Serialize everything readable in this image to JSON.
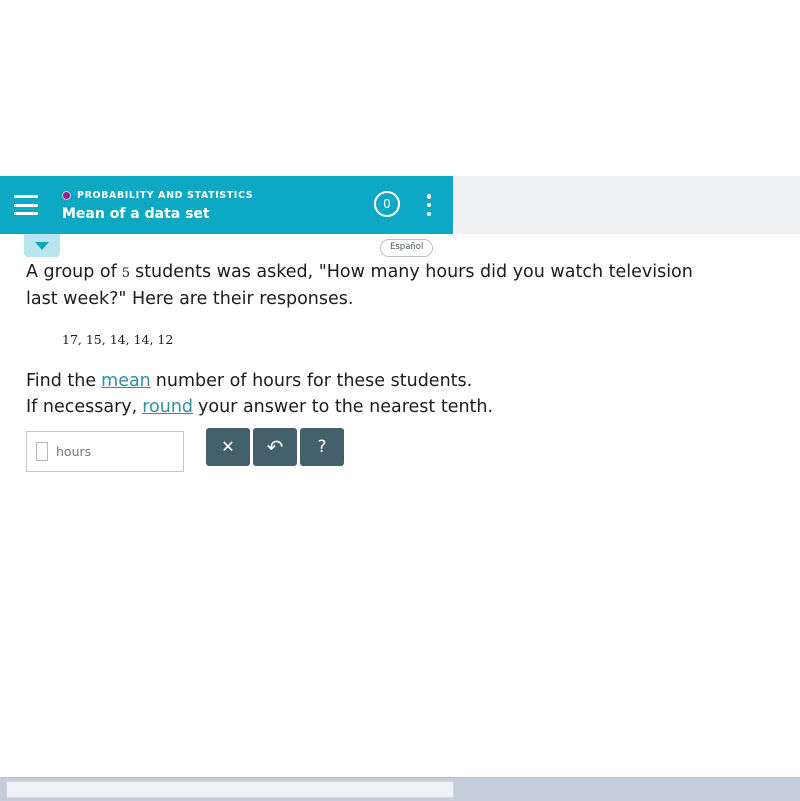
{
  "topbar": {
    "menu_icon": "hamburger-icon",
    "course_label": "PROBABILITY AND STATISTICS",
    "course_dot_color": "#a21d8c",
    "lesson_title": "Mean of a data set",
    "score_badge": "0",
    "kebab_icon": "more-vertical-icon",
    "background_color": "#0da8c3"
  },
  "toolbar": {
    "collapse_icon": "caret-down-icon",
    "espanol_label": "Español"
  },
  "problem": {
    "statement_part1": "A group of",
    "student_count": "5",
    "statement_part2": "students was asked, \"How many hours did you watch television",
    "statement_line2": "last week?\" Here are their responses.",
    "dataset": "17, 15, 14, 14, 12",
    "question_line1_pre": "Find the",
    "question_line1_link": "mean",
    "question_line1_post": "number of hours for these students.",
    "question_line2_pre": "If necessary,",
    "question_line2_link": "round",
    "question_line2_post": "your answer to the nearest tenth.",
    "link_color": "#2d8fa2"
  },
  "answer": {
    "value": "",
    "placeholder": "",
    "unit_label": "hours"
  },
  "tools": {
    "clear_label": "✕",
    "clear_name": "clear-button",
    "undo_label": "↶",
    "undo_name": "undo-button",
    "help_label": "?",
    "help_name": "help-button",
    "button_color": "#44606b"
  },
  "scrollbar": {
    "orientation": "horizontal",
    "thumb_color": "#f1f4f6",
    "track_color": "#c4ceda"
  }
}
